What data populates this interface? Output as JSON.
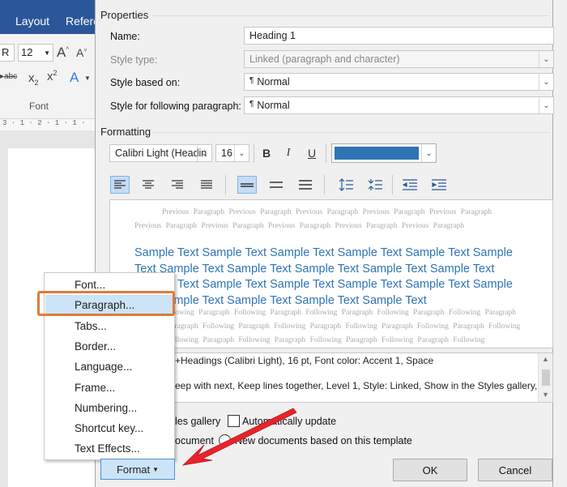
{
  "word": {
    "tabs": [
      "Layout",
      "Refere"
    ],
    "font_name": "R",
    "font_size": "12",
    "font_group_label": "Font",
    "ruler_text": "3 · 1 · 2 · 1 · 1 ·"
  },
  "dialog": {
    "properties_label": "Properties",
    "name_label": "Name:",
    "name_value": "Heading 1",
    "style_type_label": "Style type:",
    "style_type_value": "Linked (paragraph and character)",
    "based_on_label": "Style based on:",
    "based_on_value": "Normal",
    "following_label": "Style for following paragraph:",
    "following_value": "Normal",
    "formatting_label": "Formatting",
    "font_value": "Calibri Light (Headin",
    "size_value": "16",
    "bold": "B",
    "italic": "I",
    "underline": "U",
    "font_color": "#2e74b5",
    "preview": {
      "prev_line1": "Previous Paragraph Previous Paragraph Previous Paragraph Previous Paragraph Previous Paragraph",
      "prev_line2": "Previous Paragraph Previous Paragraph Previous Paragraph Previous Paragraph Previous Paragraph",
      "sample_lines": [
        "Sample Text Sample Text Sample Text Sample Text Sample Text Sample",
        "Text Sample Text Sample Text Sample Text Sample Text Sample Text",
        "Sample Text Sample Text Sample Text Sample Text Sample Text Sample",
        "Text Sample Text Sample Text Sample Text Sample Text"
      ],
      "follow_lines": [
        "ollowing Paragraph Following Paragraph Following Paragraph Following Paragraph Following Paragraph",
        "Paragraph Following Paragraph Following Paragraph Following Paragraph Following Paragraph Following",
        "Following Paragraph Following Paragraph Following Paragraph Following Paragraph Following"
      ]
    },
    "description_lines": [
      "+Headings (Calibri Light), 16 pt, Font color: Accent 1, Space",
      "eep with next, Keep lines together, Level 1, Style: Linked, Show in the Styles gallery,"
    ],
    "add_gallery_label": "les gallery",
    "auto_update_label": "Automatically update",
    "only_doc_label": "ocument",
    "new_docs_label": "New documents based on this template",
    "format_label": "Format",
    "ok_label": "OK",
    "cancel_label": "Cancel"
  },
  "format_menu": {
    "items": [
      "Font...",
      "Paragraph...",
      "Tabs...",
      "Border...",
      "Language...",
      "Frame...",
      "Numbering...",
      "Shortcut key...",
      "Text Effects..."
    ],
    "highlighted_index": 1
  },
  "colors": {
    "word_blue": "#2b579a",
    "highlight_box": "#e07b39",
    "arrow": "#e8242a",
    "menu_highlight": "#cce4f7"
  }
}
